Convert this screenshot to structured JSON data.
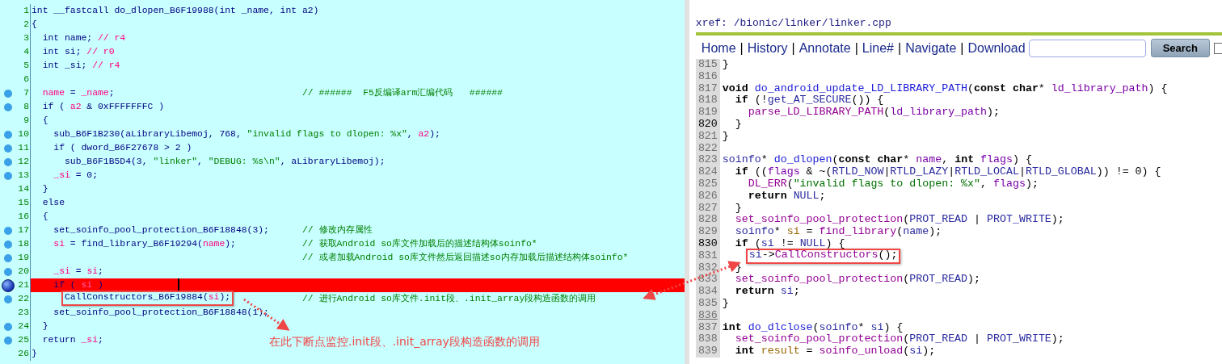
{
  "pseudocode": {
    "lines": [
      {
        "number": "1",
        "breakpoint": false,
        "current": false,
        "code": [
          {
            "kind": "t",
            "text": "int __fastcall do_dlopen_B6F19988(int _name, int a2)"
          }
        ]
      },
      {
        "number": "2",
        "breakpoint": false,
        "current": false,
        "code": [
          {
            "kind": "t",
            "text": "{"
          }
        ]
      },
      {
        "number": "3",
        "breakpoint": false,
        "current": false,
        "code": [
          {
            "kind": "t",
            "text": "  int name; "
          },
          {
            "kind": "v",
            "text": "// r4"
          }
        ]
      },
      {
        "number": "4",
        "breakpoint": false,
        "current": false,
        "code": [
          {
            "kind": "t",
            "text": "  int si; "
          },
          {
            "kind": "v",
            "text": "// r0"
          }
        ]
      },
      {
        "number": "5",
        "breakpoint": false,
        "current": false,
        "code": [
          {
            "kind": "t",
            "text": "  int _si; "
          },
          {
            "kind": "v",
            "text": "// r4"
          }
        ]
      },
      {
        "number": "6",
        "breakpoint": false,
        "current": false
      },
      {
        "number": "7",
        "breakpoint": true,
        "current": false,
        "code": [
          {
            "kind": "v",
            "text": "  name"
          },
          {
            "kind": "t",
            "text": " = "
          },
          {
            "kind": "v",
            "text": "_name"
          },
          {
            "kind": "t",
            "text": ";"
          }
        ],
        "comment": "// ######  F5反编译arm汇编代码   ######"
      },
      {
        "number": "8",
        "breakpoint": true,
        "current": false,
        "code": [
          {
            "kind": "t",
            "text": "  if ( "
          },
          {
            "kind": "v",
            "text": "a2"
          },
          {
            "kind": "t",
            "text": " & 0xFFFFFFFC )"
          }
        ]
      },
      {
        "number": "9",
        "breakpoint": false,
        "current": false,
        "code": [
          {
            "kind": "t",
            "text": "  {"
          }
        ]
      },
      {
        "number": "10",
        "breakpoint": true,
        "current": false,
        "code": [
          {
            "kind": "t",
            "text": "    sub_B6F1B230(aLibraryLibemoj, 768, "
          },
          {
            "kind": "s",
            "text": "\"invalid flags to dlopen: %x\""
          },
          {
            "kind": "t",
            "text": ", "
          },
          {
            "kind": "v",
            "text": "a2"
          },
          {
            "kind": "t",
            "text": ");"
          }
        ]
      },
      {
        "number": "11",
        "breakpoint": true,
        "current": false,
        "code": [
          {
            "kind": "t",
            "text": "    if ( dword_B6F27678 > 2 )"
          }
        ]
      },
      {
        "number": "12",
        "breakpoint": true,
        "current": false,
        "code": [
          {
            "kind": "t",
            "text": "      sub_B6F1B5D4(3, "
          },
          {
            "kind": "s",
            "text": "\"linker\""
          },
          {
            "kind": "t",
            "text": ", "
          },
          {
            "kind": "s",
            "text": "\"DEBUG: %s\\n\""
          },
          {
            "kind": "t",
            "text": ", aLibraryLibemoj);"
          }
        ]
      },
      {
        "number": "13",
        "breakpoint": true,
        "current": false,
        "code": [
          {
            "kind": "v",
            "text": "    _si"
          },
          {
            "kind": "t",
            "text": " = 0;"
          }
        ]
      },
      {
        "number": "14",
        "breakpoint": false,
        "current": false,
        "code": [
          {
            "kind": "t",
            "text": "  }"
          }
        ]
      },
      {
        "number": "15",
        "breakpoint": false,
        "current": false,
        "code": [
          {
            "kind": "t",
            "text": "  else"
          }
        ]
      },
      {
        "number": "16",
        "breakpoint": false,
        "current": false,
        "code": [
          {
            "kind": "t",
            "text": "  {"
          }
        ]
      },
      {
        "number": "17",
        "breakpoint": true,
        "current": false,
        "code": [
          {
            "kind": "t",
            "text": "    set_soinfo_pool_protection_B6F18848(3);"
          }
        ],
        "comment": "// 修改内存属性"
      },
      {
        "number": "18",
        "breakpoint": true,
        "current": false,
        "code": [
          {
            "kind": "v",
            "text": "    si"
          },
          {
            "kind": "t",
            "text": " = find_library_B6F19294("
          },
          {
            "kind": "v",
            "text": "name"
          },
          {
            "kind": "t",
            "text": ");"
          }
        ],
        "comment": "// 获取Android so库文件加载后的描述结构体soinfo*"
      },
      {
        "number": "19",
        "breakpoint": true,
        "current": false,
        "comment": "// 或者加载Android so库文件然后返回描述so内存加载后描述结构体soinfo*"
      },
      {
        "number": "20",
        "breakpoint": true,
        "current": false,
        "code": [
          {
            "kind": "v",
            "text": "    _si"
          },
          {
            "kind": "t",
            "text": " = "
          },
          {
            "kind": "v",
            "text": "si"
          },
          {
            "kind": "t",
            "text": ";"
          }
        ]
      },
      {
        "number": "21",
        "breakpoint": true,
        "current": true,
        "code": [
          {
            "kind": "t",
            "text": "    if ( "
          },
          {
            "kind": "v",
            "text": "si"
          },
          {
            "kind": "t",
            "text": " )"
          }
        ]
      },
      {
        "number": "22",
        "breakpoint": true,
        "current": false,
        "boxed": [
          {
            "kind": "t",
            "text": "CallConstructors_B6F19884("
          },
          {
            "kind": "v",
            "text": "si"
          },
          {
            "kind": "t",
            "text": ");"
          }
        ],
        "comment": "// 进行Android so库文件.init段、.init_array段构造函数的调用"
      },
      {
        "number": "23",
        "breakpoint": false,
        "current": false,
        "code": [
          {
            "kind": "t",
            "text": "    set_soinfo_pool_protection_B6F18848(1);"
          }
        ]
      },
      {
        "number": "24",
        "breakpoint": true,
        "current": false,
        "code": [
          {
            "kind": "t",
            "text": "  }"
          }
        ]
      },
      {
        "number": "25",
        "breakpoint": true,
        "current": false,
        "code": [
          {
            "kind": "t",
            "text": "  return "
          },
          {
            "kind": "v",
            "text": "_si"
          },
          {
            "kind": "t",
            "text": ";"
          }
        ]
      },
      {
        "number": "26",
        "breakpoint": false,
        "current": false,
        "code": [
          {
            "kind": "t",
            "text": "}"
          }
        ]
      }
    ],
    "annotation": "在此下断点监控.init段、.init_array段构造函数的调用"
  },
  "source_browser": {
    "breadcrumb": "xref: /bionic/linker/linker.cpp",
    "nav_links": [
      "Home",
      "History",
      "Annotate",
      "Line#",
      "Navigate",
      "Download"
    ],
    "separator": "|",
    "search_button": "Search",
    "option_checkbox": {
      "checked": false
    },
    "lines": [
      {
        "number": "815",
        "strong": false,
        "underlined": false,
        "code": [
          {
            "kind": "p",
            "text": "}"
          }
        ]
      },
      {
        "number": "816",
        "strong": false,
        "underlined": false
      },
      {
        "number": "817",
        "strong": false,
        "underlined": false,
        "code": [
          {
            "kind": "k",
            "text": "void "
          },
          {
            "kind": "d",
            "text": "do_android_update_LD_LIBRARY_PATH"
          },
          {
            "kind": "p",
            "text": "("
          },
          {
            "kind": "k",
            "text": "const char"
          },
          {
            "kind": "p",
            "text": "* "
          },
          {
            "kind": "v",
            "text": "ld_library_path"
          },
          {
            "kind": "p",
            "text": ") {"
          }
        ]
      },
      {
        "number": "818",
        "strong": false,
        "underlined": false,
        "code": [
          {
            "kind": "k",
            "text": "  if"
          },
          {
            "kind": "p",
            "text": " (!"
          },
          {
            "kind": "m",
            "text": "get_AT_SECURE"
          },
          {
            "kind": "p",
            "text": "()) {"
          }
        ]
      },
      {
        "number": "819",
        "strong": false,
        "underlined": false,
        "code": [
          {
            "kind": "c",
            "text": "    parse_LD_LIBRARY_PATH"
          },
          {
            "kind": "p",
            "text": "("
          },
          {
            "kind": "v",
            "text": "ld_library_path"
          },
          {
            "kind": "p",
            "text": ");"
          }
        ]
      },
      {
        "number": "820",
        "strong": true,
        "underlined": false,
        "code": [
          {
            "kind": "p",
            "text": "  }"
          }
        ]
      },
      {
        "number": "821",
        "strong": false,
        "underlined": false,
        "code": [
          {
            "kind": "p",
            "text": "}"
          }
        ]
      },
      {
        "number": "822",
        "strong": false,
        "underlined": false
      },
      {
        "number": "823",
        "strong": false,
        "underlined": false,
        "code": [
          {
            "kind": "m",
            "text": "soinfo"
          },
          {
            "kind": "p",
            "text": "* "
          },
          {
            "kind": "d",
            "text": "do_dlopen"
          },
          {
            "kind": "p",
            "text": "("
          },
          {
            "kind": "k",
            "text": "const char"
          },
          {
            "kind": "p",
            "text": "* "
          },
          {
            "kind": "v",
            "text": "name"
          },
          {
            "kind": "p",
            "text": ", "
          },
          {
            "kind": "k",
            "text": "int "
          },
          {
            "kind": "v",
            "text": "flags"
          },
          {
            "kind": "p",
            "text": ") {"
          }
        ]
      },
      {
        "number": "824",
        "strong": false,
        "underlined": false,
        "code": [
          {
            "kind": "k",
            "text": "  if"
          },
          {
            "kind": "p",
            "text": " (("
          },
          {
            "kind": "v",
            "text": "flags"
          },
          {
            "kind": "p",
            "text": " & ~("
          },
          {
            "kind": "m",
            "text": "RTLD_NOW"
          },
          {
            "kind": "p",
            "text": "|"
          },
          {
            "kind": "m",
            "text": "RTLD_LAZY"
          },
          {
            "kind": "p",
            "text": "|"
          },
          {
            "kind": "m",
            "text": "RTLD_LOCAL"
          },
          {
            "kind": "p",
            "text": "|"
          },
          {
            "kind": "m",
            "text": "RTLD_GLOBAL"
          },
          {
            "kind": "p",
            "text": ")) != 0) {"
          }
        ]
      },
      {
        "number": "825",
        "strong": false,
        "underlined": false,
        "code": [
          {
            "kind": "c",
            "text": "    DL_ERR"
          },
          {
            "kind": "p",
            "text": "("
          },
          {
            "kind": "s",
            "text": "\"invalid flags to dlopen: %x\""
          },
          {
            "kind": "p",
            "text": ", "
          },
          {
            "kind": "v",
            "text": "flags"
          },
          {
            "kind": "p",
            "text": ");"
          }
        ]
      },
      {
        "number": "826",
        "strong": false,
        "underlined": false,
        "code": [
          {
            "kind": "k",
            "text": "    return "
          },
          {
            "kind": "m",
            "text": "NULL"
          },
          {
            "kind": "p",
            "text": ";"
          }
        ]
      },
      {
        "number": "827",
        "strong": false,
        "underlined": false,
        "code": [
          {
            "kind": "p",
            "text": "  }"
          }
        ]
      },
      {
        "number": "828",
        "strong": false,
        "underlined": false,
        "code": [
          {
            "kind": "c",
            "text": "  set_soinfo_pool_protection"
          },
          {
            "kind": "p",
            "text": "("
          },
          {
            "kind": "m",
            "text": "PROT_READ"
          },
          {
            "kind": "p",
            "text": " | "
          },
          {
            "kind": "m",
            "text": "PROT_WRITE"
          },
          {
            "kind": "p",
            "text": ");"
          }
        ]
      },
      {
        "number": "829",
        "strong": false,
        "underlined": false,
        "code": [
          {
            "kind": "m",
            "text": "  soinfo"
          },
          {
            "kind": "p",
            "text": "* "
          },
          {
            "kind": "l",
            "text": "si"
          },
          {
            "kind": "p",
            "text": " = "
          },
          {
            "kind": "c",
            "text": "find_library"
          },
          {
            "kind": "p",
            "text": "("
          },
          {
            "kind": "m",
            "text": "name"
          },
          {
            "kind": "p",
            "text": ");"
          }
        ]
      },
      {
        "number": "830",
        "strong": true,
        "underlined": false,
        "code": [
          {
            "kind": "k",
            "text": "  if"
          },
          {
            "kind": "p",
            "text": " ("
          },
          {
            "kind": "m",
            "text": "si"
          },
          {
            "kind": "p",
            "text": " != "
          },
          {
            "kind": "m",
            "text": "NULL"
          },
          {
            "kind": "p",
            "text": ") {"
          }
        ]
      },
      {
        "number": "831",
        "strong": false,
        "underlined": false,
        "boxed": [
          {
            "kind": "m",
            "text": "si"
          },
          {
            "kind": "p",
            "text": "->"
          },
          {
            "kind": "c",
            "text": "CallConstructors"
          },
          {
            "kind": "p",
            "text": "();"
          }
        ]
      },
      {
        "number": "832",
        "strong": false,
        "underlined": false,
        "code": [
          {
            "kind": "p",
            "text": "  }"
          }
        ]
      },
      {
        "number": "833",
        "strong": false,
        "underlined": false,
        "code": [
          {
            "kind": "c",
            "text": "  set_soinfo_pool_protection"
          },
          {
            "kind": "p",
            "text": "("
          },
          {
            "kind": "m",
            "text": "PROT_READ"
          },
          {
            "kind": "p",
            "text": ");"
          }
        ]
      },
      {
        "number": "834",
        "strong": false,
        "underlined": false,
        "code": [
          {
            "kind": "k",
            "text": "  return "
          },
          {
            "kind": "m",
            "text": "si"
          },
          {
            "kind": "p",
            "text": ";"
          }
        ]
      },
      {
        "number": "835",
        "strong": false,
        "underlined": false,
        "code": [
          {
            "kind": "p",
            "text": "}"
          }
        ]
      },
      {
        "number": "836",
        "strong": false,
        "underlined": true
      },
      {
        "number": "837",
        "strong": false,
        "underlined": false,
        "code": [
          {
            "kind": "k",
            "text": "int "
          },
          {
            "kind": "d",
            "text": "do_dlclose"
          },
          {
            "kind": "p",
            "text": "("
          },
          {
            "kind": "m",
            "text": "soinfo"
          },
          {
            "kind": "p",
            "text": "* "
          },
          {
            "kind": "m",
            "text": "si"
          },
          {
            "kind": "p",
            "text": ") {"
          }
        ]
      },
      {
        "number": "838",
        "strong": false,
        "underlined": false,
        "code": [
          {
            "kind": "c",
            "text": "  set_soinfo_pool_protection"
          },
          {
            "kind": "p",
            "text": "("
          },
          {
            "kind": "m",
            "text": "PROT_READ"
          },
          {
            "kind": "p",
            "text": " | "
          },
          {
            "kind": "m",
            "text": "PROT_WRITE"
          },
          {
            "kind": "p",
            "text": ");"
          }
        ]
      },
      {
        "number": "839",
        "strong": false,
        "underlined": false,
        "code": [
          {
            "kind": "k",
            "text": "  int "
          },
          {
            "kind": "l",
            "text": "result"
          },
          {
            "kind": "p",
            "text": " = "
          },
          {
            "kind": "c",
            "text": "soinfo_unload"
          },
          {
            "kind": "p",
            "text": "("
          },
          {
            "kind": "m",
            "text": "si"
          },
          {
            "kind": "p",
            "text": ");"
          }
        ]
      }
    ]
  }
}
